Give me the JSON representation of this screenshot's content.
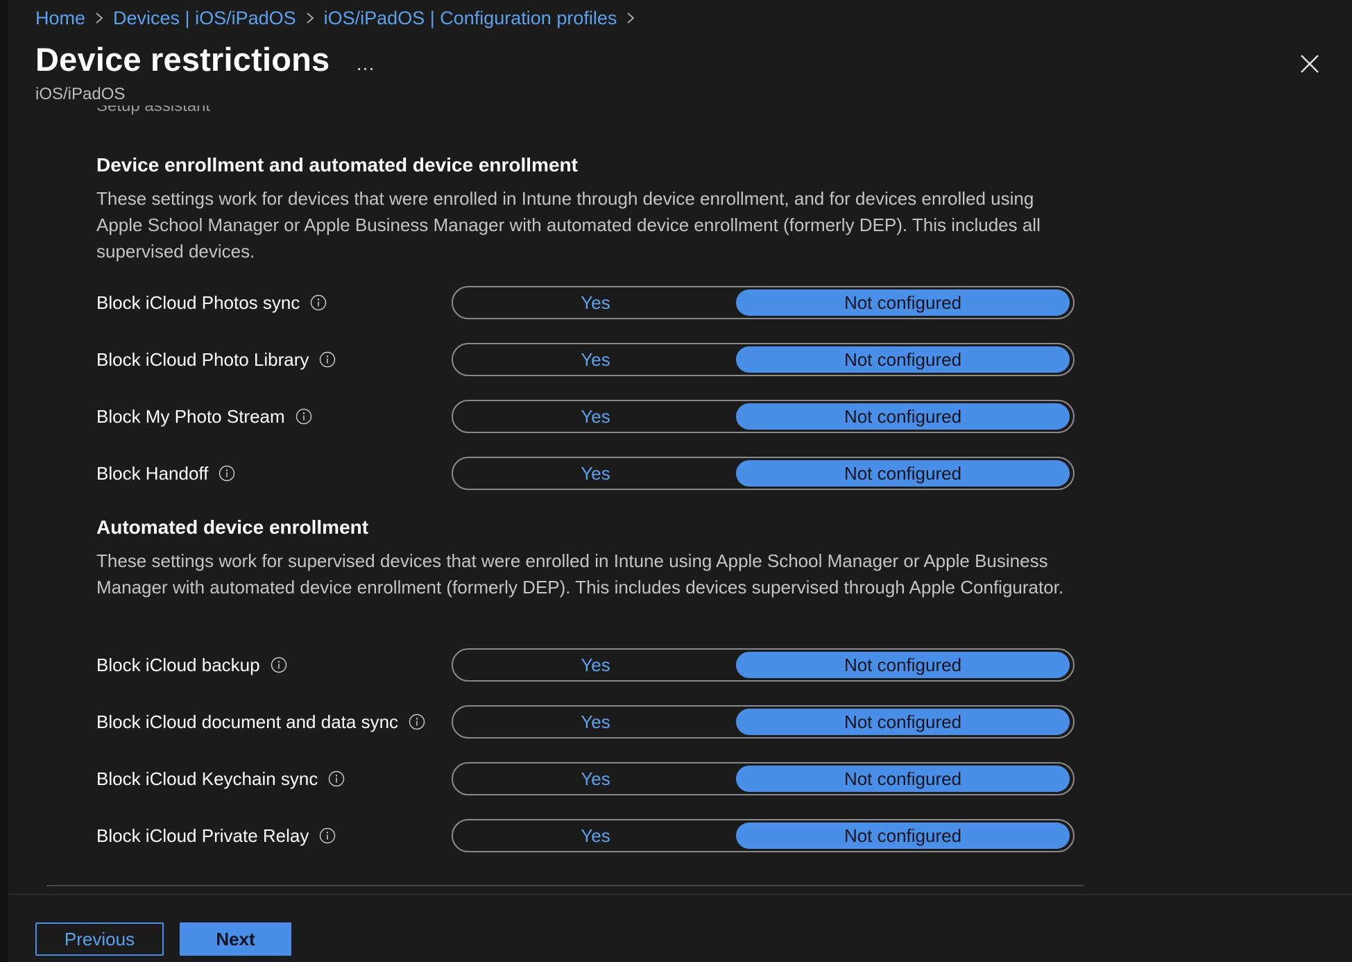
{
  "breadcrumb": [
    {
      "label": "Home"
    },
    {
      "label": "Devices | iOS/iPadOS"
    },
    {
      "label": "iOS/iPadOS | Configuration profiles"
    }
  ],
  "header": {
    "title": "Device restrictions",
    "more_icon": "…",
    "subtitle": "iOS/iPadOS",
    "close_icon": "close-icon"
  },
  "content": {
    "clipped_text": "Setup assistant",
    "sections": [
      {
        "title": "Device enrollment and automated device enrollment",
        "description": "These settings work for devices that were enrolled in Intune through device enrollment, and for devices enrolled using Apple School Manager or Apple Business Manager with automated device enrollment (formerly DEP). This includes all supervised devices.",
        "settings": [
          {
            "label": "Block iCloud Photos sync",
            "yes": "Yes",
            "not_configured": "Not configured",
            "selected": "Not configured"
          },
          {
            "label": "Block iCloud Photo Library",
            "yes": "Yes",
            "not_configured": "Not configured",
            "selected": "Not configured"
          },
          {
            "label": "Block My Photo Stream",
            "yes": "Yes",
            "not_configured": "Not configured",
            "selected": "Not configured"
          },
          {
            "label": "Block Handoff",
            "yes": "Yes",
            "not_configured": "Not configured",
            "selected": "Not configured"
          }
        ]
      },
      {
        "title": "Automated device enrollment",
        "description": "These settings work for supervised devices that were enrolled in Intune using Apple School Manager or Apple Business Manager with automated device enrollment (formerly DEP). This includes devices supervised through Apple Configurator.",
        "settings": [
          {
            "label": "Block iCloud backup",
            "yes": "Yes",
            "not_configured": "Not configured",
            "selected": "Not configured"
          },
          {
            "label": "Block iCloud document and data sync",
            "yes": "Yes",
            "not_configured": "Not configured",
            "selected": "Not configured"
          },
          {
            "label": "Block iCloud Keychain sync",
            "yes": "Yes",
            "not_configured": "Not configured",
            "selected": "Not configured"
          },
          {
            "label": "Block iCloud Private Relay",
            "yes": "Yes",
            "not_configured": "Not configured",
            "selected": "Not configured"
          }
        ]
      }
    ]
  },
  "footer": {
    "previous_label": "Previous",
    "next_label": "Next"
  },
  "colors": {
    "background": "#1b1b1b",
    "accent": "#4a8fe7",
    "link": "#5aa2ee"
  }
}
